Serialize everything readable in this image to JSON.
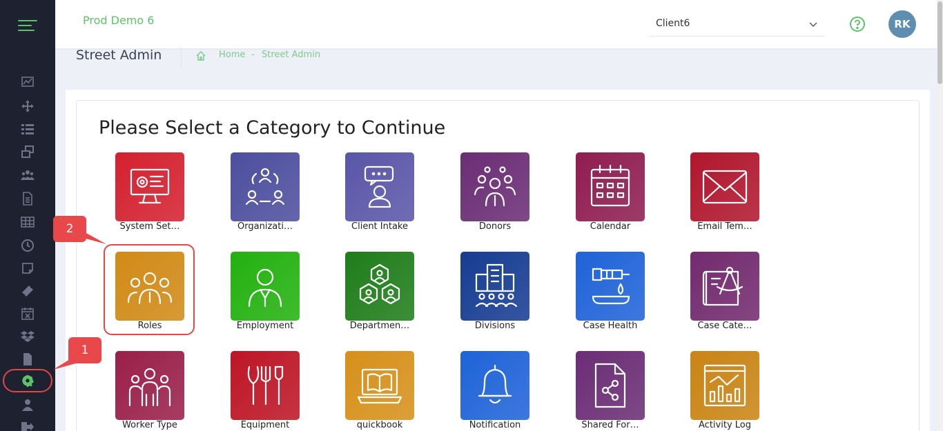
{
  "header": {
    "brand": "Prod Demo 6",
    "client_select": {
      "value": "Client6"
    },
    "avatar_initials": "RK"
  },
  "subheader": {
    "page_title": "Street Admin",
    "breadcrumb": {
      "home": "Home",
      "separator": "-",
      "current": "Street Admin"
    }
  },
  "main": {
    "heading": "Please Select a Category to Continue",
    "tiles": [
      {
        "label": "System Set…",
        "icon": "computer-settings-icon",
        "color": "#d4202f"
      },
      {
        "label": "Organizati…",
        "icon": "organization-cycle-icon",
        "color": "#4d4e9e"
      },
      {
        "label": "Client Intake",
        "icon": "client-chat-icon",
        "color": "#5a56a8"
      },
      {
        "label": "Donors",
        "icon": "donors-group-icon",
        "color": "#6a2d74"
      },
      {
        "label": "Calendar",
        "icon": "calendar-icon",
        "color": "#8f1d50"
      },
      {
        "label": "Email Tem…",
        "icon": "envelope-icon",
        "color": "#b0162d"
      },
      {
        "label": "Roles",
        "icon": "roles-people-icon",
        "color": "#d18a16"
      },
      {
        "label": "Employment",
        "icon": "employee-icon",
        "color": "#23b10f"
      },
      {
        "label": "Departmen…",
        "icon": "department-hexagon-icon",
        "color": "#1f7d1a"
      },
      {
        "label": "Divisions",
        "icon": "building-people-icon",
        "color": "#163c92"
      },
      {
        "label": "Case Health",
        "icon": "health-syringe-icon",
        "color": "#1f63d8"
      },
      {
        "label": "Case Cate…",
        "icon": "blueprint-compass-icon",
        "color": "#722a6e"
      },
      {
        "label": "Worker Type",
        "icon": "workers-icon",
        "color": "#9a1f48"
      },
      {
        "label": "Equipment",
        "icon": "garden-tools-icon",
        "color": "#bd1525"
      },
      {
        "label": "quickbook",
        "icon": "laptop-book-icon",
        "color": "#d6901a"
      },
      {
        "label": "Notification",
        "icon": "bell-icon",
        "color": "#1f63d8"
      },
      {
        "label": "Shared For…",
        "icon": "shared-file-icon",
        "color": "#6a2d74"
      },
      {
        "label": "Activity Log",
        "icon": "activity-chart-icon",
        "color": "#c98414"
      }
    ]
  },
  "annotations": {
    "callout_1": "1",
    "callout_2": "2"
  },
  "colors": {
    "accent": "#5ec26a",
    "sidebar": "#1e2130",
    "highlight": "#e04848"
  }
}
